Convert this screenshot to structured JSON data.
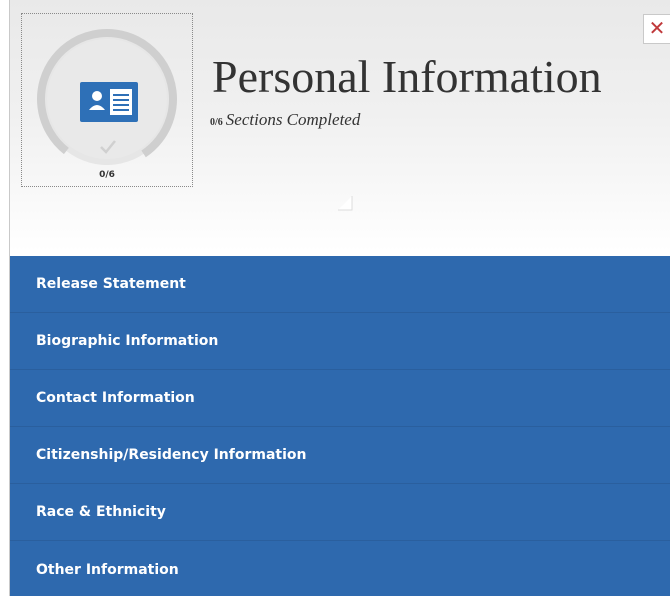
{
  "header": {
    "title": "Personal Information",
    "progress_small": "0/6",
    "progress_text": "Sections Completed",
    "progress_count": "0/6",
    "progress_fraction": 0,
    "close_glyph": "✕"
  },
  "icons": {
    "badge": "id-card-icon",
    "check": "check-icon",
    "close": "close-icon"
  },
  "colors": {
    "accent": "#2e70b7",
    "section_bg": "#2e69ae",
    "close": "#c0393b"
  },
  "sections": [
    {
      "label": "Release Statement"
    },
    {
      "label": "Biographic Information"
    },
    {
      "label": "Contact Information"
    },
    {
      "label": "Citizenship/Residency Information"
    },
    {
      "label": "Race & Ethnicity"
    },
    {
      "label": "Other Information"
    }
  ]
}
